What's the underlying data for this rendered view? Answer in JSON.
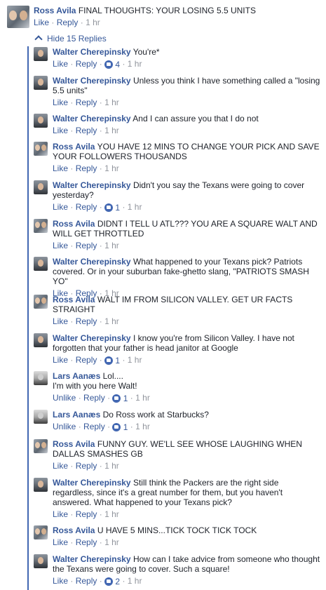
{
  "top_comment": {
    "author": "Ross Avila",
    "text": "FINAL THOUGHTS: YOUR LOSING 5.5 UNITS",
    "like": "Like",
    "reply": "Reply",
    "time": "1 hr"
  },
  "hide_replies": "Hide 15 Replies",
  "replies": [
    {
      "author": "Walter Cherepinsky",
      "avatar": "walter-avatar",
      "text": "You're*",
      "like": "Like",
      "reply": "Reply",
      "reactions": "4",
      "time": "1 hr"
    },
    {
      "author": "Walter Cherepinsky",
      "avatar": "walter-avatar",
      "text": "Unless you think I have something called a \"losing 5.5 units\"",
      "like": "Like",
      "reply": "Reply",
      "reactions": "",
      "time": "1 hr"
    },
    {
      "author": "Walter Cherepinsky",
      "avatar": "walter-avatar",
      "text": "And I can assure you that I do not",
      "like": "Like",
      "reply": "Reply",
      "reactions": "",
      "time": "1 hr"
    },
    {
      "author": "Ross Avila",
      "avatar": "ross-avatar",
      "text": "YOU HAVE 12 MINS TO CHANGE YOUR PICK AND SAVE YOUR FOLLOWERS THOUSANDS",
      "like": "Like",
      "reply": "Reply",
      "reactions": "",
      "time": "1 hr"
    },
    {
      "author": "Walter Cherepinsky",
      "avatar": "walter-avatar",
      "text": "Didn't you say the Texans were going to cover yesterday?",
      "like": "Like",
      "reply": "Reply",
      "reactions": "1",
      "time": "1 hr"
    },
    {
      "author": "Ross Avila",
      "avatar": "ross-avatar",
      "text": "DIDNT I TELL U ATL??? YOU ARE A SQUARE WALT AND WILL GET THROTTLED",
      "like": "Like",
      "reply": "Reply",
      "reactions": "",
      "time": "1 hr"
    },
    {
      "author": "Walter Cherepinsky",
      "avatar": "walter-avatar",
      "text": "What happened to your Texans pick? Patriots covered. Or in your suburban fake-ghetto slang, \"PATRIOTS SMASH YO\"",
      "like": "Like",
      "reply": "Reply",
      "reactions": "",
      "time": "1 hr"
    },
    {
      "author": "Ross Avila",
      "avatar": "ross-avatar",
      "text": "WALT IM FROM SILICON VALLEY. GET UR FACTS STRAIGHT",
      "like": "Like",
      "reply": "Reply",
      "reactions": "",
      "time": "1 hr"
    },
    {
      "author": "Walter Cherepinsky",
      "avatar": "walter-avatar",
      "text": "I know you're from Silicon Valley. I have not forgotten that your father is head janitor at Google",
      "like": "Like",
      "reply": "Reply",
      "reactions": "1",
      "time": "1 hr"
    },
    {
      "author": "Lars Aanæs",
      "avatar": "lars-avatar",
      "text": "Lol....",
      "text2": "I'm with you here Walt!",
      "like": "Unlike",
      "reply": "Reply",
      "reactions": "1",
      "time": "1 hr"
    },
    {
      "author": "Lars Aanæs",
      "avatar": "lars-avatar",
      "text": "Do Ross work at Starbucks?",
      "like": "Unlike",
      "reply": "Reply",
      "reactions": "1",
      "time": "1 hr"
    },
    {
      "author": "Ross Avila",
      "avatar": "ross-avatar",
      "text": "FUNNY GUY. WE'LL SEE WHOSE LAUGHING WHEN DALLAS SMASHES GB",
      "like": "Like",
      "reply": "Reply",
      "reactions": "",
      "time": "1 hr"
    },
    {
      "author": "Walter Cherepinsky",
      "avatar": "walter-avatar",
      "text": "Still think the Packers are the right side regardless, since it's a great number for them, but you haven't answered. What happened to your Texans pick?",
      "like": "Like",
      "reply": "Reply",
      "reactions": "",
      "time": "1 hr"
    },
    {
      "author": "Ross Avila",
      "avatar": "ross-avatar",
      "text": "U HAVE 5 MINS...TICK TOCK TICK TOCK",
      "like": "Like",
      "reply": "Reply",
      "reactions": "",
      "time": "1 hr"
    },
    {
      "author": "Walter Cherepinsky",
      "avatar": "walter-avatar",
      "text": "How can I take advice from someone who thought the Texans were going to cover. Such a square!",
      "like": "Like",
      "reply": "Reply",
      "reactions": "2",
      "time": "1 hr"
    }
  ],
  "colors": {
    "link": "#365899",
    "meta": "#90949c",
    "thread": "#4267b2"
  }
}
